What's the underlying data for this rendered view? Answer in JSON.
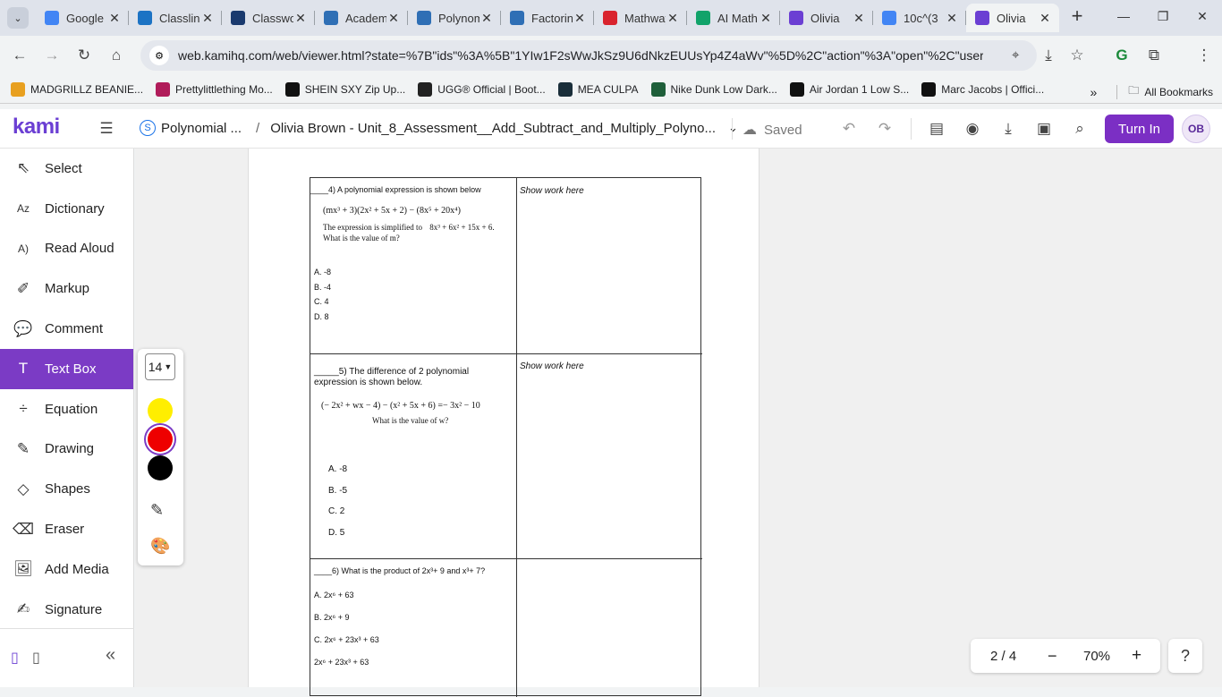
{
  "browser": {
    "tabs": [
      {
        "title": "Google",
        "favicon": "google-icon",
        "color": "#4285f4"
      },
      {
        "title": "Classlink",
        "favicon": "classlink-icon",
        "color": "#1c73c4"
      },
      {
        "title": "Classwork",
        "favicon": "hac-icon",
        "color": "#1a3a6e"
      },
      {
        "title": "Academy",
        "favicon": "p-icon",
        "color": "#2f6fb5"
      },
      {
        "title": "Polynomial",
        "favicon": "p-icon",
        "color": "#2f6fb5"
      },
      {
        "title": "Factoring",
        "favicon": "p-icon",
        "color": "#2f6fb5"
      },
      {
        "title": "Mathway",
        "favicon": "mathway-icon",
        "color": "#d9232d"
      },
      {
        "title": "AI Math",
        "favicon": "ai-math-icon",
        "color": "#11a36a"
      },
      {
        "title": "Olivia",
        "favicon": "kami-icon",
        "color": "#6b3fd3"
      },
      {
        "title": "10c^(3",
        "favicon": "google-icon",
        "color": "#4285f4"
      },
      {
        "title": "Olivia",
        "favicon": "kami-icon",
        "color": "#6b3fd3",
        "active": true
      }
    ],
    "url": "web.kamihq.com/web/viewer.html?state=%7B\"ids\"%3A%5B\"1YIw1F2sWwJkSz9U6dNkzEUUsYp4Z4aWv\"%5D%2C\"action\"%3A\"open\"%2C\"userId\"%3A\"...",
    "bookmarks": [
      {
        "label": "MADGRILLZ BEANIE...",
        "color": "#e8a020"
      },
      {
        "label": "Prettylittlething Mo...",
        "color": "#b01c5a"
      },
      {
        "label": "SHEIN SXY Zip Up...",
        "color": "#111111"
      },
      {
        "label": "UGG® Official | Boot...",
        "color": "#222222"
      },
      {
        "label": "MEA CULPA",
        "color": "#1a2e3a"
      },
      {
        "label": "Nike Dunk Low Dark...",
        "color": "#1f5f3a"
      },
      {
        "label": "Air Jordan 1 Low S...",
        "color": "#111111"
      },
      {
        "label": "Marc Jacobs | Offici...",
        "color": "#111111"
      }
    ],
    "all_bookmarks": "All Bookmarks"
  },
  "kami": {
    "logo": "kami",
    "class_name": "Polynomial ...",
    "separator": "/",
    "doc_title": "Olivia Brown - Unit_8_Assessment__Add_Subtract_and_Multiply_Polyno...",
    "saved": "Saved",
    "turn_in": "Turn In",
    "avatar": "OB"
  },
  "tools": [
    {
      "label": "Select",
      "icon": "select-arrow-icon"
    },
    {
      "label": "Dictionary",
      "icon": "dictionary-icon"
    },
    {
      "label": "Read Aloud",
      "icon": "read-aloud-icon"
    },
    {
      "label": "Markup",
      "icon": "markup-icon"
    },
    {
      "label": "Comment",
      "icon": "comment-icon"
    },
    {
      "label": "Text Box",
      "icon": "text-box-icon",
      "active": true
    },
    {
      "label": "Equation",
      "icon": "equation-icon"
    },
    {
      "label": "Drawing",
      "icon": "drawing-icon"
    },
    {
      "label": "Shapes",
      "icon": "shapes-icon"
    },
    {
      "label": "Eraser",
      "icon": "eraser-icon"
    },
    {
      "label": "Add Media",
      "icon": "add-media-icon"
    },
    {
      "label": "Signature",
      "icon": "signature-icon"
    }
  ],
  "palette": {
    "font_size": "14",
    "colors": [
      "#ffee00",
      "#ee0000",
      "#000000"
    ],
    "selected_color": "#ee0000"
  },
  "document": {
    "q4": {
      "prompt": "____4) A polynomial expression is shown below",
      "expr": "(mx³ + 3)(2x² + 5x + 2) − (8x⁵ + 20x⁴)",
      "simplified_label": "The expression is simplified to",
      "simplified": "8x³ + 6x² + 15x + 6.",
      "question": "What is the value of m?",
      "options": [
        "A.   -8",
        "B.   -4",
        "C.   4",
        "D.   8"
      ],
      "work": "Show work here"
    },
    "q5": {
      "prompt": "_____5) The difference of 2 polynomial expression is shown below.",
      "expr": "(− 2x² + wx − 4) − (x² + 5x + 6) =− 3x² − 10",
      "question": "What is the value of w?",
      "options": [
        "A.  -8",
        "B.  -5",
        "C.  2",
        "D.  5"
      ],
      "work": "Show work here"
    },
    "q6": {
      "prompt": "____6) What is the product of 2x³+ 9 and x³+ 7?",
      "options": [
        "A.  2x⁶ + 63",
        "B.  2x⁶ + 9",
        "C.  2x⁶ + 23x³ + 63",
        "2x⁶ + 23x³ + 63"
      ]
    }
  },
  "pager": {
    "page": "2 / 4",
    "zoom": "70%"
  }
}
